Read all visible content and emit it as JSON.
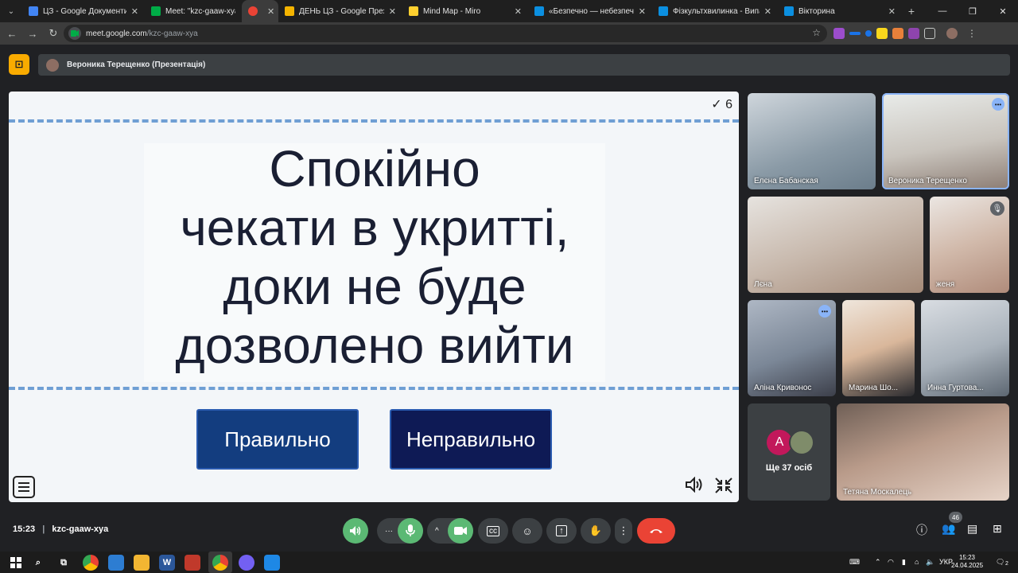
{
  "browser": {
    "tabs": [
      {
        "label": "ЦЗ - Google Документи",
        "color": "#4285f4"
      },
      {
        "label": "Meet: \"kzc-gaaw-xya\"",
        "color": "#00ac47"
      },
      {
        "label": "",
        "color": "#ea4335"
      },
      {
        "label": "ДЕНЬ ЦЗ - Google Презентації",
        "color": "#f4b400"
      },
      {
        "label": "Mind Map - Miro",
        "color": "#ffd02f"
      },
      {
        "label": "«Безпечно — небезпечно» - I",
        "color": "#0b8fe0"
      },
      {
        "label": "Фізкультхвилинка - Випадкові",
        "color": "#0b8fe0"
      },
      {
        "label": "Вікторина",
        "color": "#0b8fe0"
      }
    ],
    "url_host": "meet.google.com",
    "url_path": "/kzc-gaaw-xya"
  },
  "presentation": {
    "presenter": "Вероника Терещенко (Презентація)"
  },
  "slide": {
    "counter": "✓ 6",
    "statement_lines": [
      "Спокійно",
      "чекати в укритті,",
      "доки не буде",
      "дозволено вийти"
    ],
    "answer_true": "Правильно",
    "answer_false": "Неправильно"
  },
  "participants": [
    {
      "name": "Елєна Бабанская"
    },
    {
      "name": "Вероника Терещенко"
    },
    {
      "name": "Лєна"
    },
    {
      "name": "женя"
    },
    {
      "name": "Аліна Кривонос"
    },
    {
      "name": "Марина Шо..."
    },
    {
      "name": "Инна Гуртова..."
    },
    {
      "name": "Тетяна Москалець"
    }
  ],
  "more": {
    "avatar_letter": "A",
    "caption": "Ще 37 осіб"
  },
  "meeting": {
    "time": "15:23",
    "code": "kzc-gaaw-xya",
    "people_count": "46"
  },
  "taskbar": {
    "lang": "УКР",
    "time": "15:23",
    "date": "24.04.2025",
    "notif_count": "2"
  }
}
